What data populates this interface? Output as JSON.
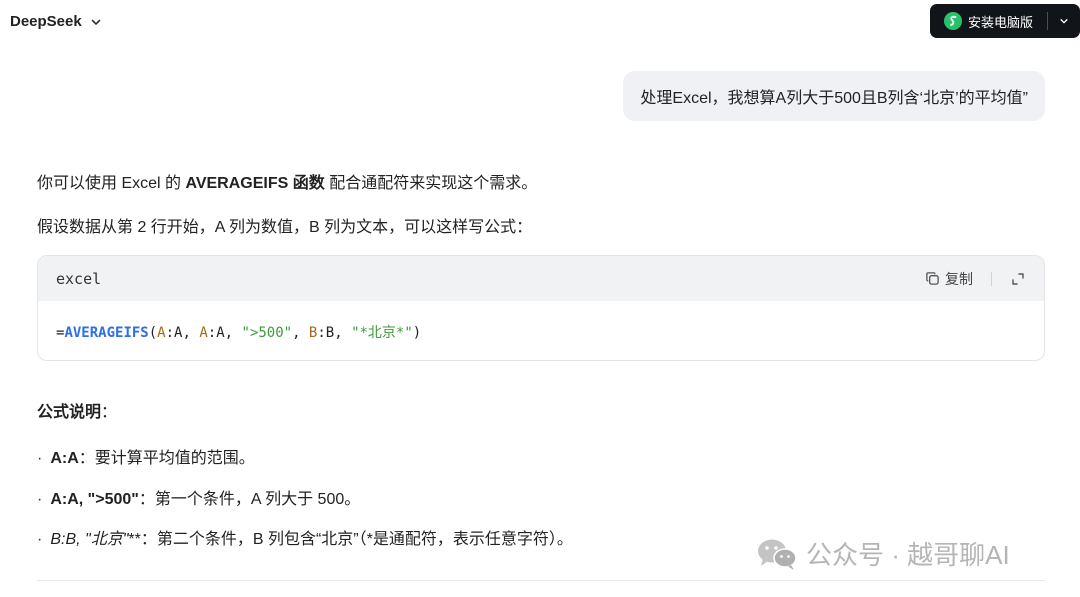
{
  "header": {
    "brand": "DeepSeek",
    "install_label": "安装电脑版"
  },
  "user_message": "处理Excel，我想算A列大于500且B列含‘北京’的平均值”",
  "answer": {
    "intro_pre": "你可以使用 Excel 的 ",
    "intro_bold": "AVERAGEIFS 函数",
    "intro_post": " 配合通配符来实现这个需求。",
    "assumption": "假设数据从第 2 行开始，A 列为数值，B 列为文本，可以这样写公式：",
    "code_block": {
      "language": "excel",
      "copy_label": "复制",
      "tokens": {
        "eq": "=",
        "fn": "AVERAGEIFS",
        "p_open": "(",
        "r1a": "A",
        "r1b": ":A, ",
        "r2a": "A",
        "r2b": ":A, ",
        "s1": "\">500\"",
        "c1": ", ",
        "r3a": "B",
        "r3b": ":B, ",
        "s2": "\"*北京*\"",
        "p_close": ")"
      }
    },
    "explain_title": "公式说明",
    "explain_colon": "：",
    "bullets": [
      {
        "bold": "A:A",
        "text": "：要计算平均值的范围。"
      },
      {
        "bold": "A:A, \">500\"",
        "text": "：第一个条件，A 列大于 500。"
      },
      {
        "italic": "B:B, \"北京\"",
        "text": "**：第二个条件，B 列包含“北京”（*是通配符，表示任意字符）。"
      }
    ],
    "bullet_marker": "·"
  },
  "watermark": "公众号 · 越哥聊AI",
  "colors": {
    "install_bg": "#111418",
    "install_logo": "#27c36b",
    "function_blue": "#2f6fe0",
    "string_green": "#3c9a3a",
    "ref_brown": "#a26a15"
  },
  "icons": {
    "brand_chevron": "chevron-down-icon",
    "install_logo": "deepseek-logo-icon",
    "install_dropdown": "chevron-down-icon",
    "copy": "copy-icon",
    "expand": "expand-icon",
    "watermark": "wechat-icon"
  }
}
